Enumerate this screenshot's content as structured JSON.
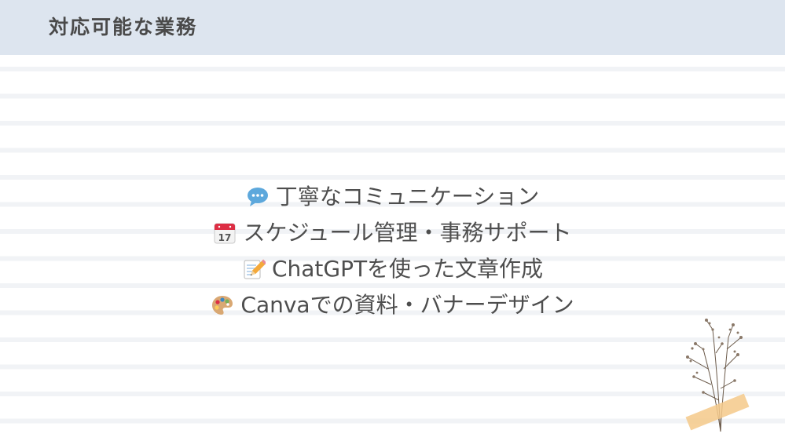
{
  "header": {
    "title": "対応可能な業務"
  },
  "services": [
    {
      "icon": "speech-balloon-icon",
      "label": "丁寧なコミュニケーション"
    },
    {
      "icon": "calendar-icon",
      "label": "スケジュール管理・事務サポート",
      "icon_text": "17"
    },
    {
      "icon": "memo-pencil-icon",
      "label": "ChatGPTを使った文章作成"
    },
    {
      "icon": "artist-palette-icon",
      "label": "Canvaでの資料・バナーデザイン"
    }
  ],
  "colors": {
    "header_background": "#dde5ef",
    "text": "#4e4e4e",
    "stripe": "#f1f3f6",
    "tape": "#f4c98a"
  },
  "decoration": {
    "icon": "dried-flower-tape-icon"
  }
}
